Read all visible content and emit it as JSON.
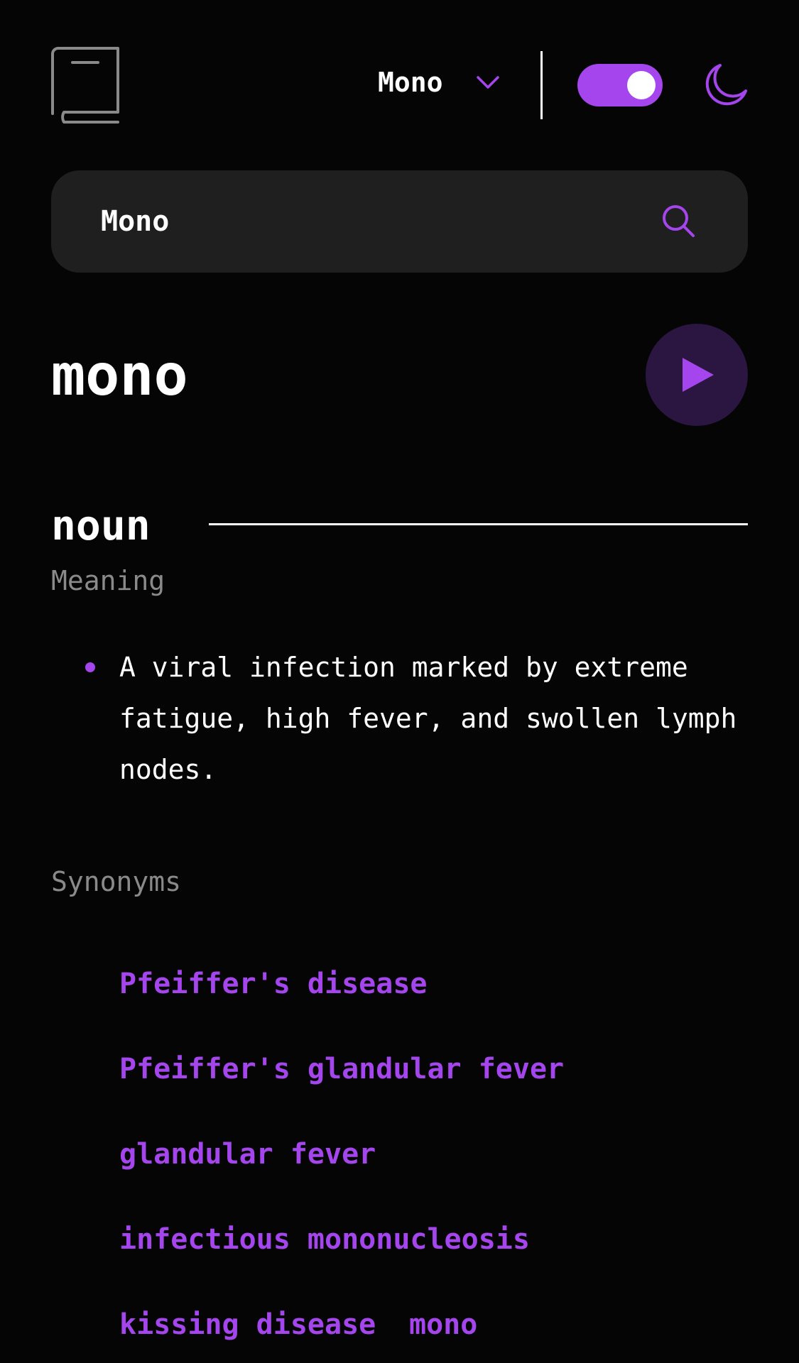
{
  "header": {
    "font_selector": {
      "selected": "Mono"
    },
    "theme_toggle": {
      "on": true
    },
    "icons": [
      "book-icon",
      "chevron-down-icon",
      "moon-icon"
    ]
  },
  "search": {
    "value": "Mono",
    "icon": "search-icon"
  },
  "entry": {
    "word": "mono",
    "play_icon": "play-icon",
    "part_of_speech": "noun",
    "meaning_label": "Meaning",
    "definitions": [
      "A viral infection marked by extreme fatigue, high fever, and swollen lymph nodes."
    ],
    "synonyms_label": "Synonyms",
    "synonyms": [
      "Pfeiffer's disease",
      "Pfeiffer's glandular fever",
      "glandular fever",
      "infectious mononucleosis",
      "kissing disease",
      "mono"
    ]
  },
  "colors": {
    "background": "#050505",
    "accent": "#a445ed",
    "surface": "#1f1f1f",
    "muted_text": "#8a8a8a",
    "play_background": "#2a1640"
  }
}
